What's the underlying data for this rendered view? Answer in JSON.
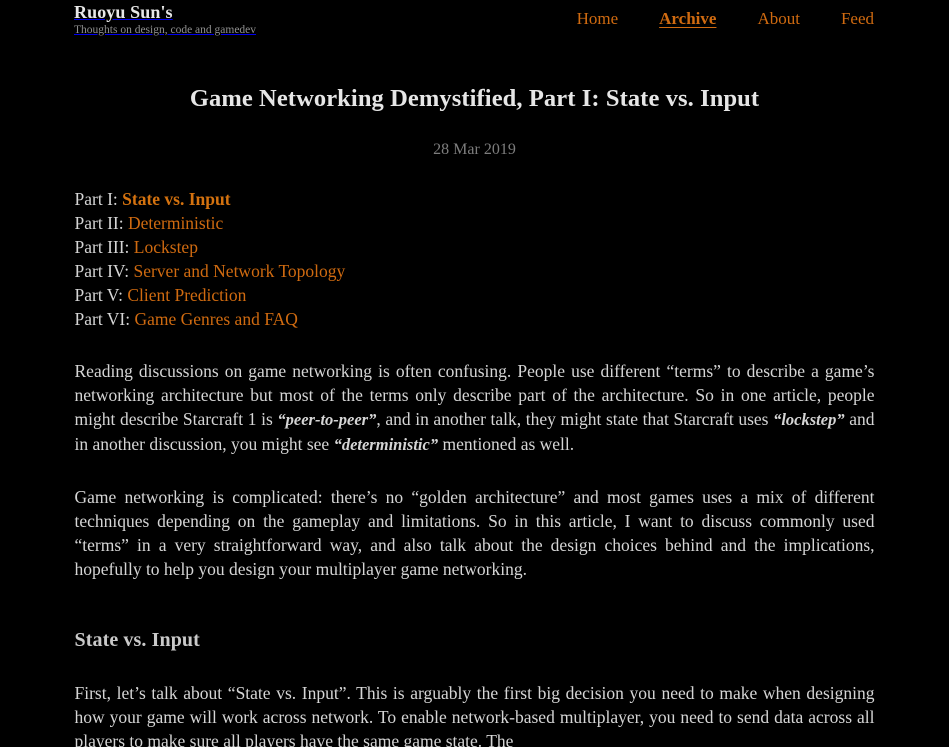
{
  "theme": {
    "background": "#000000",
    "body_text": "#d5d5d5",
    "accent_link": "#cf6a10",
    "muted_text": "#7d7d7d",
    "heading_text": "#e6e6e6"
  },
  "header": {
    "brand_title": "Ruoyu Sun's",
    "brand_tagline": "Thoughts on design, code and gamedev",
    "nav": [
      {
        "label": "Home",
        "current": false
      },
      {
        "label": "Archive",
        "current": true
      },
      {
        "label": "About",
        "current": false
      },
      {
        "label": "Feed",
        "current": false
      }
    ]
  },
  "post": {
    "title": "Game Networking Demystified, Part I: State vs. Input",
    "date": "28 Mar 2019",
    "part_list": [
      {
        "label": "Part I: ",
        "link": "State vs. Input",
        "current": true
      },
      {
        "label": "Part II: ",
        "link": "Deterministic",
        "current": false
      },
      {
        "label": "Part III: ",
        "link": "Lockstep",
        "current": false
      },
      {
        "label": "Part IV: ",
        "link": "Server and Network Topology",
        "current": false
      },
      {
        "label": "Part V: ",
        "link": "Client Prediction",
        "current": false
      },
      {
        "label": "Part VI: ",
        "link": "Game Genres and FAQ",
        "current": false
      }
    ],
    "paragraph_1": {
      "seg_1": "Reading discussions on game networking is often confusing. People use different “terms” to describe a game’s networking architecture but most of the terms only describe part of the architecture. So in one article, people might describe Starcraft 1 is ",
      "em_1": "“peer-to-peer”",
      "seg_2": ", and in another talk, they might state that Starcraft uses ",
      "em_2": "“lockstep”",
      "seg_3": " and in another discussion, you might see ",
      "em_3": "“deterministic”",
      "seg_4": " mentioned as well."
    },
    "paragraph_2": "Game networking is complicated: there’s no “golden architecture” and most games uses a mix of different techniques depending on the gameplay and limitations. So in this article, I want to discuss commonly used “terms” in a very straightforward way, and also talk about the design choices behind and the implications, hopefully to help you design your multiplayer game networking.",
    "section_heading": "State vs. Input",
    "paragraph_3": "First, let’s talk about “State vs. Input”. This is arguably the first big decision you need to make when designing how your game will work across network. To enable network-based multiplayer, you need to send data across all players to make sure all players have the same game state. The"
  }
}
